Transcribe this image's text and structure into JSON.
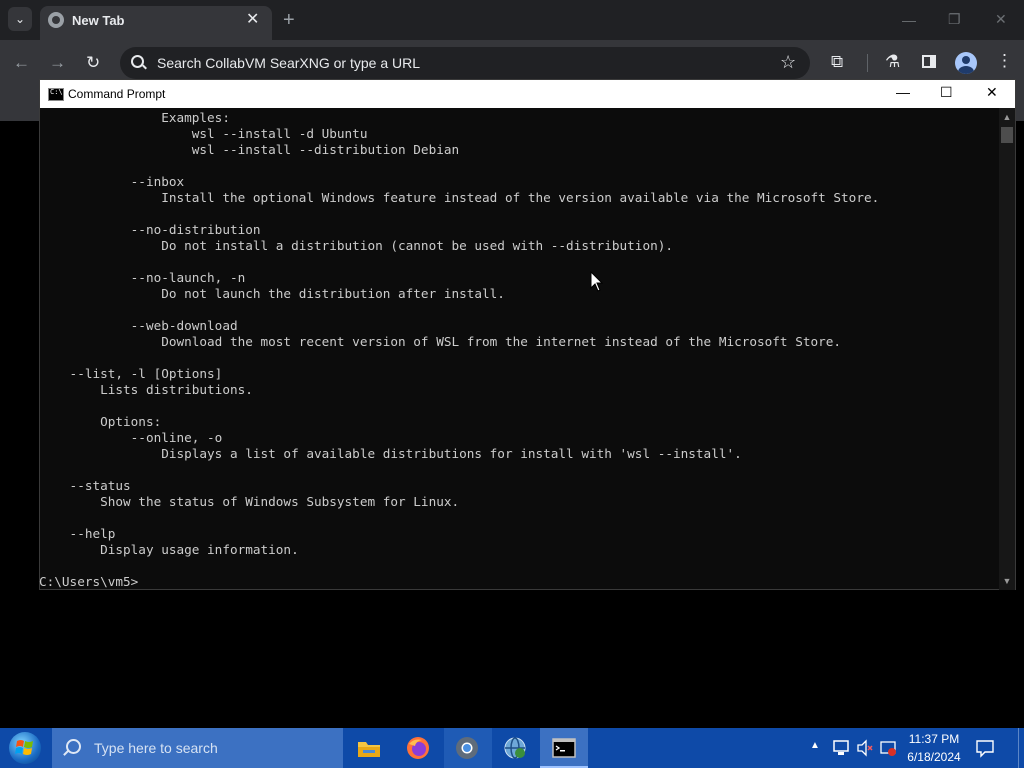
{
  "browser": {
    "tab_title": "New Tab",
    "tab_close": "✕",
    "new_tab": "+",
    "omnibox_placeholder": "Search CollabVM SearXNG or type a URL",
    "window_controls": {
      "minimize": "—",
      "restore": "❐",
      "close": "✕"
    },
    "nav": {
      "back": "←",
      "forward": "→",
      "reload": "↻"
    },
    "toolbar_icons": [
      "star-icon",
      "extensions-icon",
      "labs-icon",
      "side-panel-icon",
      "profile-icon",
      "menu-icon"
    ],
    "colors": {
      "tabstrip": "#202124",
      "toolbar": "#35363a",
      "omnibox": "#202124"
    }
  },
  "cmd": {
    "title": "Command Prompt",
    "controls": {
      "minimize": "—",
      "maximize": "☐",
      "close": "✕"
    },
    "lines": [
      "                Examples:",
      "                    wsl --install -d Ubuntu",
      "                    wsl --install --distribution Debian",
      "",
      "            --inbox",
      "                Install the optional Windows feature instead of the version available via the Microsoft Store.",
      "",
      "            --no-distribution",
      "                Do not install a distribution (cannot be used with --distribution).",
      "",
      "            --no-launch, -n",
      "                Do not launch the distribution after install.",
      "",
      "            --web-download",
      "                Download the most recent version of WSL from the internet instead of the Microsoft Store.",
      "",
      "    --list, -l [Options]",
      "        Lists distributions.",
      "",
      "        Options:",
      "            --online, -o",
      "                Displays a list of available distributions for install with 'wsl --install'.",
      "",
      "    --status",
      "        Show the status of Windows Subsystem for Linux.",
      "",
      "    --help",
      "        Display usage information.",
      "",
      "C:\\Users\\vm5>"
    ],
    "colors": {
      "background": "#0c0c0c",
      "text": "#cccccc"
    }
  },
  "taskbar": {
    "search_placeholder": "Type here to search",
    "pinned": [
      "file-explorer-icon",
      "firefox-icon",
      "chrome-icon",
      "network-globe-icon",
      "command-prompt-icon"
    ],
    "tray": {
      "time": "11:37 PM",
      "date": "6/18/2024"
    },
    "colors": {
      "background": "#0e4aa8",
      "search": "#3c71c2"
    }
  }
}
